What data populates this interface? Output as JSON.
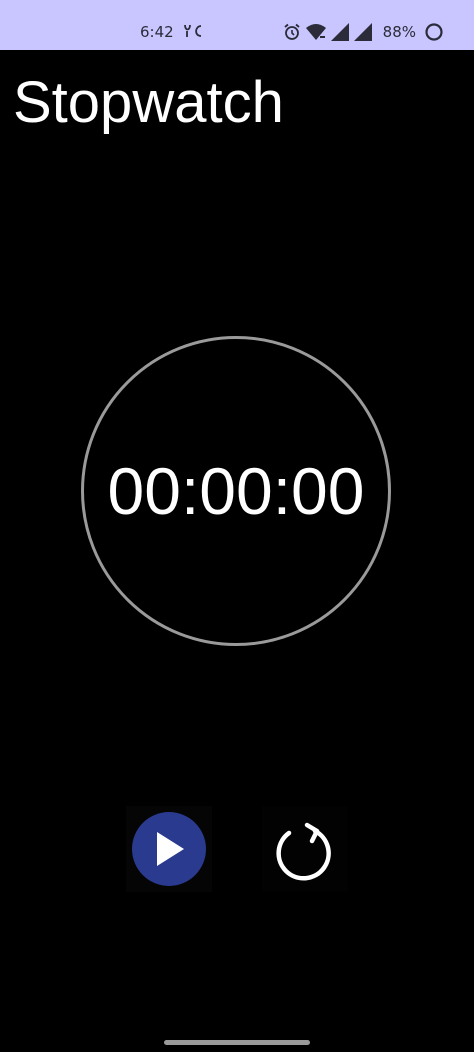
{
  "status_bar": {
    "time": "6:42",
    "battery_percent": "88%",
    "icons": [
      "notification-icon",
      "alarm-icon",
      "wifi-icon",
      "signal-icon",
      "signal-icon",
      "battery-icon"
    ],
    "background": "#c9c6ff"
  },
  "app": {
    "title": "Stopwatch"
  },
  "timer": {
    "display": "00:00:00",
    "ring_color": "#9a9a9a"
  },
  "controls": {
    "play_icon": "play-icon",
    "play_color": "#2a3a8f",
    "reset_icon": "reset-icon"
  }
}
